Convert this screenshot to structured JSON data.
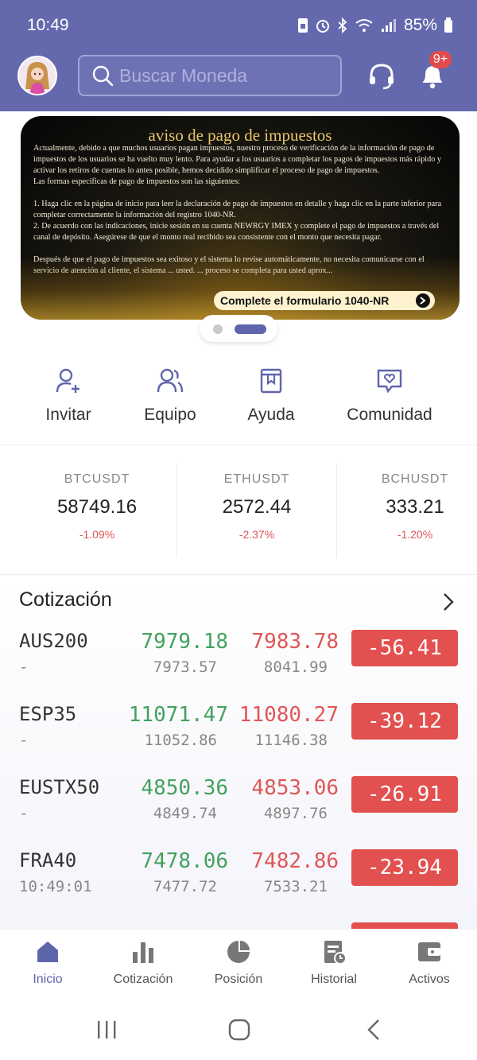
{
  "status_bar": {
    "time": "10:49",
    "battery": "85%"
  },
  "header": {
    "search_placeholder": "Buscar Moneda",
    "notification_badge": "9+"
  },
  "banner": {
    "title": "aviso de pago de impuestos",
    "paragraphs": [
      "Actualmente, debido a que muchos usuarios pagan impuestos, nuestro proceso de verificación de la información de pago de impuestos de los usuarios se ha vuelto muy lento. Para ayudar a los usuarios a completar los pagos de impuestos más rápido y activar los retiros de cuentas lo antes posible, hemos decidido simplificar el proceso de pago de impuestos.",
      "Las formas específicas de pago de impuestos son las siguientes:",
      "1. Haga clic en la página de inicio para leer la declaración de pago de impuestos en detalle y haga clic en la parte inferior para completar correctamente la información del registro 1040-NR.",
      "2. De acuerdo con las indicaciones, inicie sesión en su cuenta NEWRGY IMEX y complete el pago de impuestos a través del canal de depósito. Asegúrese de que el monto real recibido sea consistente con el monto que necesita pagar.",
      "Después de que el pago de impuestos sea exitoso y el sistema lo revise automáticamente, no necesita comunicarse con el servicio de atención al cliente, el sistema ... usted. ... proceso se completa para usted aprox..."
    ],
    "cta_label": "Complete el formulario 1040-NR"
  },
  "quick_actions": [
    {
      "label": "Invitar",
      "icon": "user-add-icon"
    },
    {
      "label": "Equipo",
      "icon": "team-icon"
    },
    {
      "label": "Ayuda",
      "icon": "help-book-icon"
    },
    {
      "label": "Comunidad",
      "icon": "community-chat-icon"
    }
  ],
  "tickers": [
    {
      "symbol": "BTCUSDT",
      "price": "58749.16",
      "change": "-1.09%"
    },
    {
      "symbol": "ETHUSDT",
      "price": "2572.44",
      "change": "-2.37%"
    },
    {
      "symbol": "BCHUSDT",
      "price": "333.21",
      "change": "-1.20%"
    }
  ],
  "quotes": {
    "title": "Cotización",
    "rows": [
      {
        "symbol": "AUS200",
        "sub": "-",
        "bid": "7979.18",
        "ask": "7983.78",
        "bid_sub": "7973.57",
        "ask_sub": "8041.99",
        "change": "-56.41"
      },
      {
        "symbol": "ESP35",
        "sub": "-",
        "bid": "11071.47",
        "ask": "11080.27",
        "bid_sub": "11052.86",
        "ask_sub": "11146.38",
        "change": "-39.12"
      },
      {
        "symbol": "EUSTX50",
        "sub": "-",
        "bid": "4850.36",
        "ask": "4853.06",
        "bid_sub": "4849.74",
        "ask_sub": "4897.76",
        "change": "-26.91"
      },
      {
        "symbol": "FRA40",
        "sub": "10:49:01",
        "bid": "7478.06",
        "ask": "7482.86",
        "bid_sub": "7477.72",
        "ask_sub": "7533.21",
        "change": "-23.94"
      }
    ]
  },
  "bottom_nav": [
    {
      "label": "Inicio",
      "icon": "home-icon",
      "active": true
    },
    {
      "label": "Cotización",
      "icon": "bar-chart-icon",
      "active": false
    },
    {
      "label": "Posición",
      "icon": "pie-chart-icon",
      "active": false
    },
    {
      "label": "Historial",
      "icon": "history-icon",
      "active": false
    },
    {
      "label": "Activos",
      "icon": "wallet-icon",
      "active": false
    }
  ],
  "colors": {
    "header": "#6469ad",
    "accent": "#5f65ab",
    "up": "#43a25d",
    "down": "#e05656",
    "change_badge": "#e2504f"
  }
}
